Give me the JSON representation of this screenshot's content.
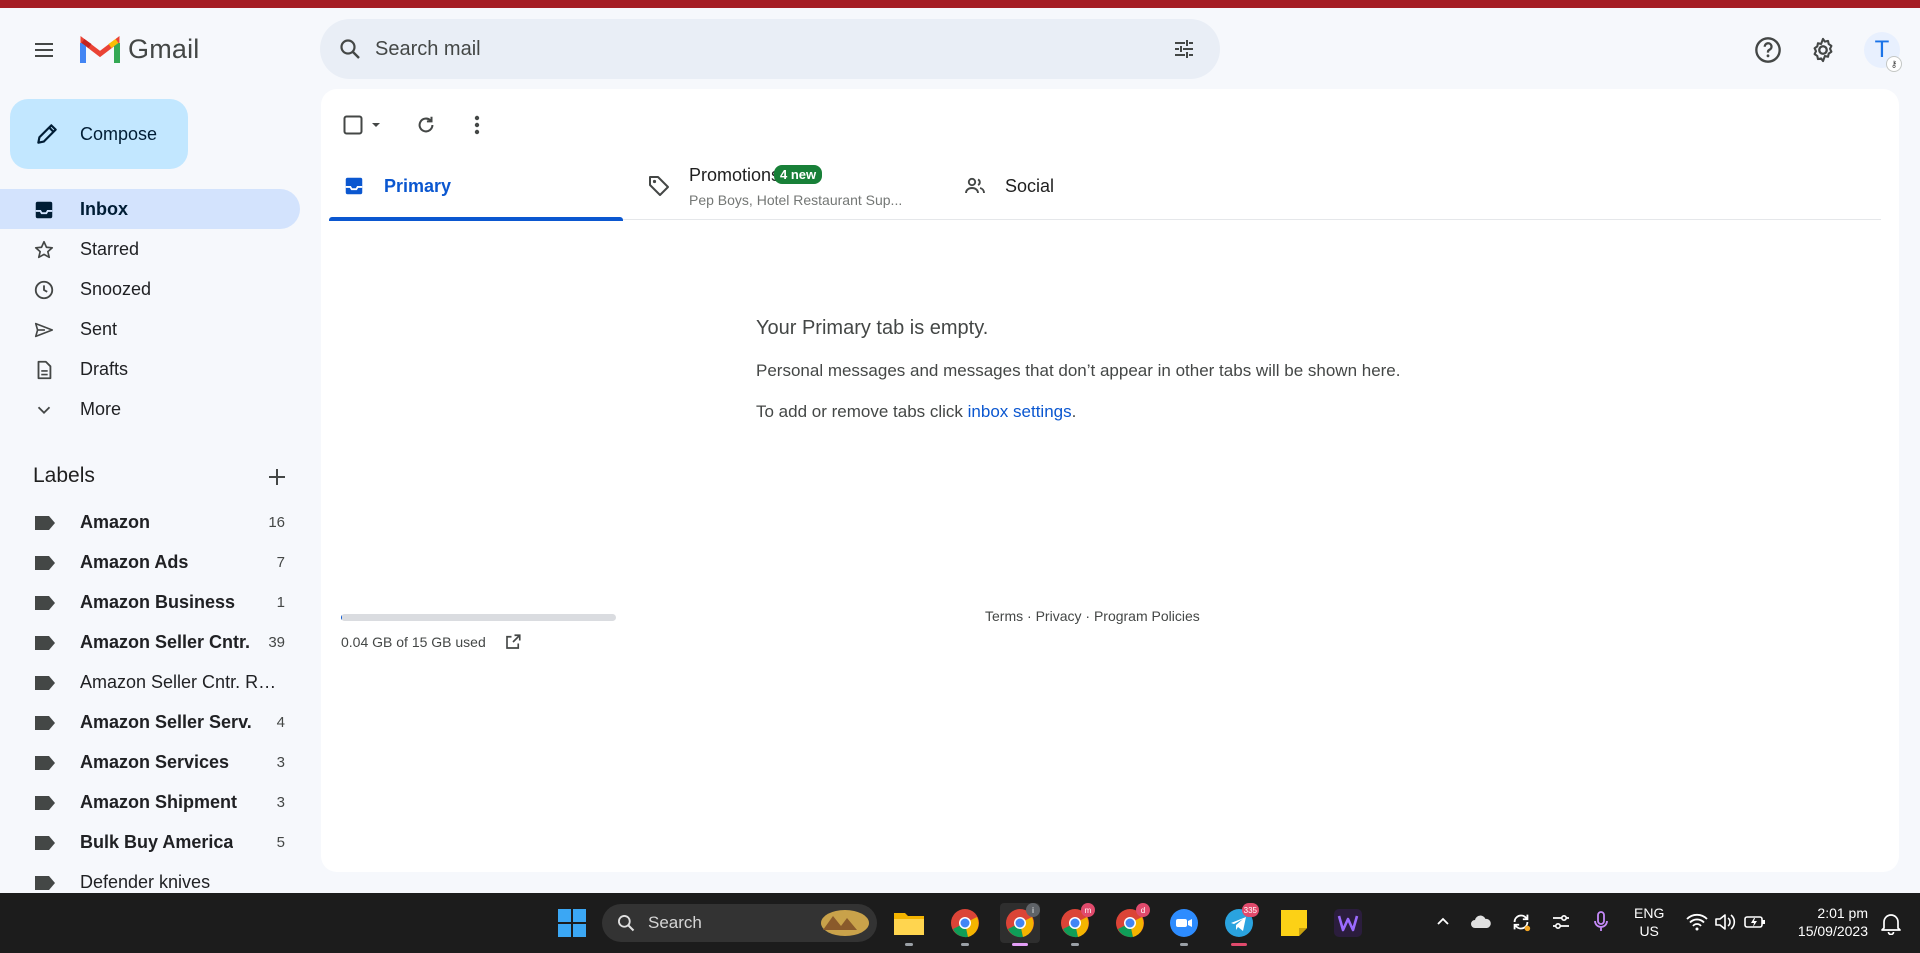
{
  "app": {
    "name": "Gmail"
  },
  "search": {
    "placeholder": "Search mail"
  },
  "account": {
    "initial": "T"
  },
  "compose": {
    "label": "Compose"
  },
  "nav": {
    "items": [
      {
        "label": "Inbox",
        "icon": "inbox-icon",
        "active": true
      },
      {
        "label": "Starred",
        "icon": "star-icon"
      },
      {
        "label": "Snoozed",
        "icon": "clock-icon"
      },
      {
        "label": "Sent",
        "icon": "send-icon"
      },
      {
        "label": "Drafts",
        "icon": "draft-icon"
      },
      {
        "label": "More",
        "icon": "chevron-down-icon"
      }
    ]
  },
  "labels": {
    "title": "Labels",
    "items": [
      {
        "name": "Amazon",
        "count": "16",
        "bold": true
      },
      {
        "name": "Amazon Ads",
        "count": "7",
        "bold": true
      },
      {
        "name": "Amazon Business",
        "count": "1",
        "bold": true
      },
      {
        "name": "Amazon Seller Cntr.",
        "count": "39",
        "bold": true
      },
      {
        "name": "Amazon Seller Cntr. Ref...",
        "count": "",
        "bold": false
      },
      {
        "name": "Amazon Seller Serv.",
        "count": "4",
        "bold": true
      },
      {
        "name": "Amazon Services",
        "count": "3",
        "bold": true
      },
      {
        "name": "Amazon Shipment",
        "count": "3",
        "bold": true
      },
      {
        "name": "Bulk Buy America",
        "count": "5",
        "bold": true
      },
      {
        "name": "Defender knives",
        "count": "",
        "bold": false
      }
    ]
  },
  "tabs": {
    "primary": {
      "label": "Primary"
    },
    "promotions": {
      "label": "Promotions",
      "badge": "4 new",
      "snippet": "Pep Boys, Hotel Restaurant Sup..."
    },
    "social": {
      "label": "Social"
    }
  },
  "empty": {
    "title": "Your Primary tab is empty.",
    "line1": "Personal messages and messages that don’t appear in other tabs will be shown here.",
    "line2_prefix": "To add or remove tabs click ",
    "line2_link": "inbox settings",
    "line2_suffix": "."
  },
  "storage": {
    "text": "0.04 GB of 15 GB used",
    "used_fraction": 0.003
  },
  "footer": {
    "terms": "Terms",
    "privacy": "Privacy",
    "policies": "Program Policies",
    "sep": " · "
  },
  "taskbar": {
    "search_label": "Search",
    "apps": [
      {
        "name": "chrome-icon",
        "badge": ""
      },
      {
        "name": "chrome-icon",
        "badge": "i"
      },
      {
        "name": "chrome-icon",
        "badge": "m"
      },
      {
        "name": "chrome-icon",
        "badge": "d"
      },
      {
        "name": "zoom-icon",
        "badge": ""
      },
      {
        "name": "telegram-icon",
        "badge": "335"
      }
    ],
    "lang_top": "ENG",
    "lang_bottom": "US",
    "time": "2:01 pm",
    "date": "15/09/2023"
  },
  "colors": {
    "accent": "#0b57d0",
    "compose_bg": "#c2e7ff",
    "active_nav": "#d3e3fd",
    "badge_green": "#188038",
    "top_strip": "#a51d24"
  }
}
